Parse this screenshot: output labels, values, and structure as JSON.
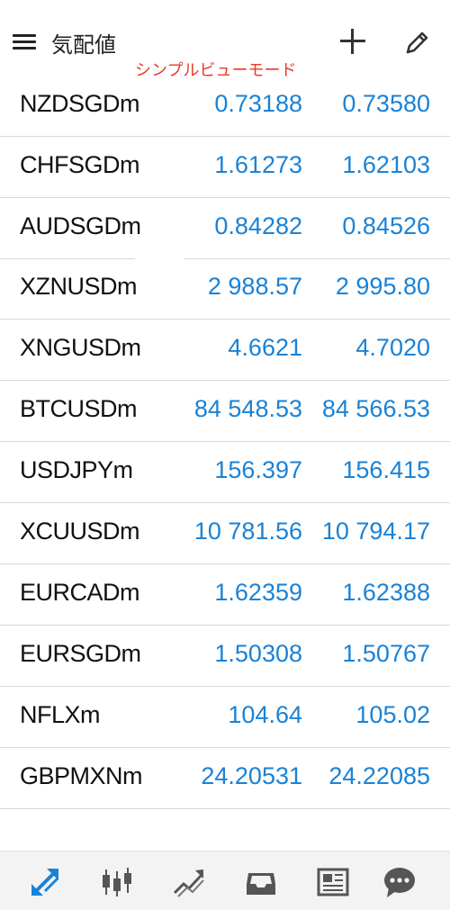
{
  "header": {
    "title": "気配値",
    "subtitle": "シンプルビューモード",
    "menu_icon": "hamburger-menu-icon",
    "add_icon": "plus-icon",
    "edit_icon": "pencil-icon"
  },
  "colors": {
    "price": "#1a82d6",
    "symbol": "#111111",
    "subtitle": "#e83b2a",
    "nav_active": "#1a82d6",
    "nav_inactive": "#555555"
  },
  "quotes": [
    {
      "symbol": "NZDSGDm",
      "bid": "0.73188",
      "ask": "0.73580"
    },
    {
      "symbol": "CHFSGDm",
      "bid": "1.61273",
      "ask": "1.62103"
    },
    {
      "symbol": "AUDSGDm",
      "bid": "0.84282",
      "ask": "0.84526"
    },
    {
      "symbol": "XZNUSDm",
      "bid": "2 988.57",
      "ask": "2 995.80"
    },
    {
      "symbol": "XNGUSDm",
      "bid": "4.6621",
      "ask": "4.7020"
    },
    {
      "symbol": "BTCUSDm",
      "bid": "84 548.53",
      "ask": "84 566.53"
    },
    {
      "symbol": "USDJPYm",
      "bid": "156.397",
      "ask": "156.415"
    },
    {
      "symbol": "XCUUSDm",
      "bid": "10 781.56",
      "ask": "10 794.17"
    },
    {
      "symbol": "EURCADm",
      "bid": "1.62359",
      "ask": "1.62388"
    },
    {
      "symbol": "EURSGDm",
      "bid": "1.50308",
      "ask": "1.50767"
    },
    {
      "symbol": "NFLXm",
      "bid": "104.64",
      "ask": "105.02"
    },
    {
      "symbol": "GBPMXNm",
      "bid": "24.20531",
      "ask": "24.22085"
    }
  ],
  "bottom_nav": [
    {
      "icon": "quotes-arrows-icon",
      "active": true
    },
    {
      "icon": "candlestick-chart-icon",
      "active": false
    },
    {
      "icon": "trade-trend-icon",
      "active": false
    },
    {
      "icon": "inbox-tray-icon",
      "active": false
    },
    {
      "icon": "news-icon",
      "active": false
    },
    {
      "icon": "chat-bubble-icon",
      "active": false
    }
  ]
}
